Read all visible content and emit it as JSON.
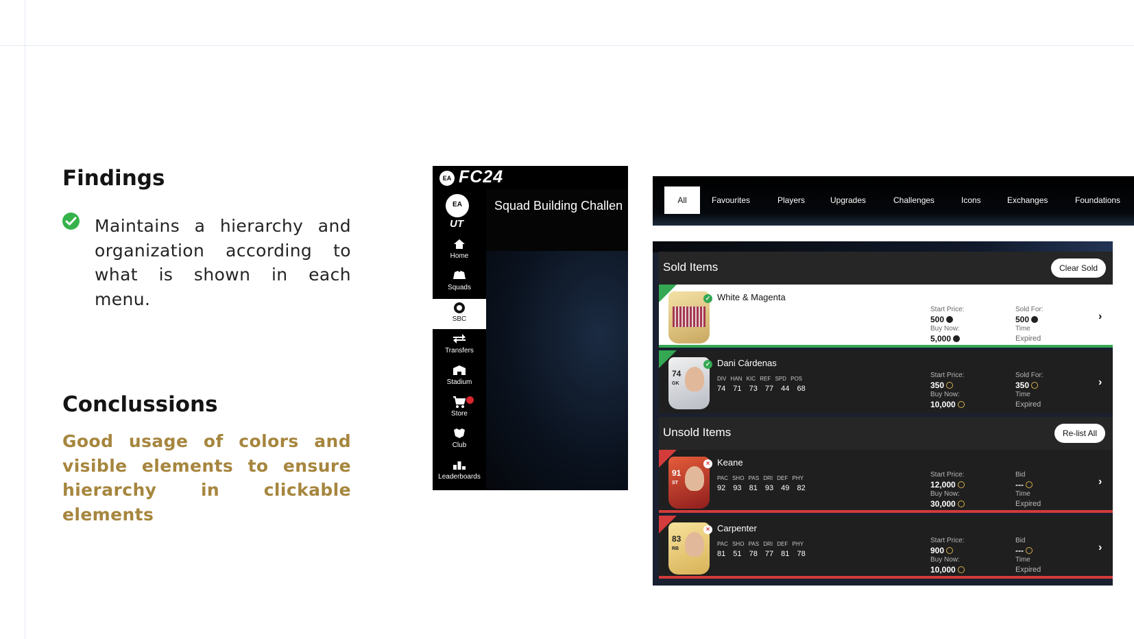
{
  "slide": {
    "findings_title": "Findings",
    "findings_text": "Maintains a hierarchy and organization according to what is shown in each menu.",
    "conclusions_title": "Conclussions",
    "conclusions_text": "Good usage of colors and visible elements to ensure hierarchy in clickable elements",
    "accent_color": "#a6863e",
    "check_color": "#35b34a"
  },
  "fc_app": {
    "logo": "FC24",
    "ea_badge": "EA",
    "ut_badge": "EA",
    "ut_text": "UT",
    "content_title": "Squad Building Challen",
    "nav": [
      {
        "label": "Home",
        "icon": "home-icon",
        "active": false
      },
      {
        "label": "Squads",
        "icon": "squads-icon",
        "active": false
      },
      {
        "label": "SBC",
        "icon": "sbc-icon",
        "active": true
      },
      {
        "label": "Transfers",
        "icon": "transfers-icon",
        "active": false
      },
      {
        "label": "Stadium",
        "icon": "stadium-icon",
        "active": false
      },
      {
        "label": "Store",
        "icon": "store-icon",
        "active": false
      },
      {
        "label": "Club",
        "icon": "club-icon",
        "active": false
      },
      {
        "label": "Leaderboards",
        "icon": "leaderboards-icon",
        "active": false
      }
    ]
  },
  "tabs": [
    "All",
    "Favourites",
    "Players",
    "Upgrades",
    "Challenges",
    "Icons",
    "Exchanges",
    "Foundations"
  ],
  "transfer_list": {
    "sold_title": "Sold Items",
    "clear_label": "Clear Sold",
    "unsold_title": "Unsold Items",
    "relist_label": "Re-list All",
    "items": [
      {
        "name": "White & Magenta",
        "start_label": "Start Price:",
        "start": "500",
        "buy_label": "Buy Now:",
        "buy": "5,000",
        "right_label": "Sold For:",
        "right": "500",
        "time_label": "Time",
        "time": "Expired"
      },
      {
        "name": "Dani Cárdenas",
        "ovr": "74",
        "pos": "GK",
        "stat_labels": "DIV HAN KIC REF SPD POS",
        "stat_values": "74 71 73 77 44 68",
        "start_label": "Start Price:",
        "start": "350",
        "buy_label": "Buy Now:",
        "buy": "10,000",
        "right_label": "Sold For:",
        "right": "350",
        "time_label": "Time",
        "time": "Expired"
      },
      {
        "name": "Keane",
        "ovr": "91",
        "pos": "ST",
        "stat_labels": "PAC SHO PAS DRI DEF PHY",
        "stat_values": "92 93 81 93 49 82",
        "start_label": "Start Price:",
        "start": "12,000",
        "buy_label": "Buy Now:",
        "buy": "30,000",
        "right_label": "Bid",
        "right": "---",
        "time_label": "Time",
        "time": "Expired"
      },
      {
        "name": "Carpenter",
        "ovr": "83",
        "pos": "RB",
        "stat_labels": "PAC SHO PAS DRI DEF PHY",
        "stat_values": "81 51 78 77 81 78",
        "start_label": "Start Price:",
        "start": "900",
        "buy_label": "Buy Now:",
        "buy": "10,000",
        "right_label": "Bid",
        "right": "---",
        "time_label": "Time",
        "time": "Expired"
      }
    ]
  }
}
